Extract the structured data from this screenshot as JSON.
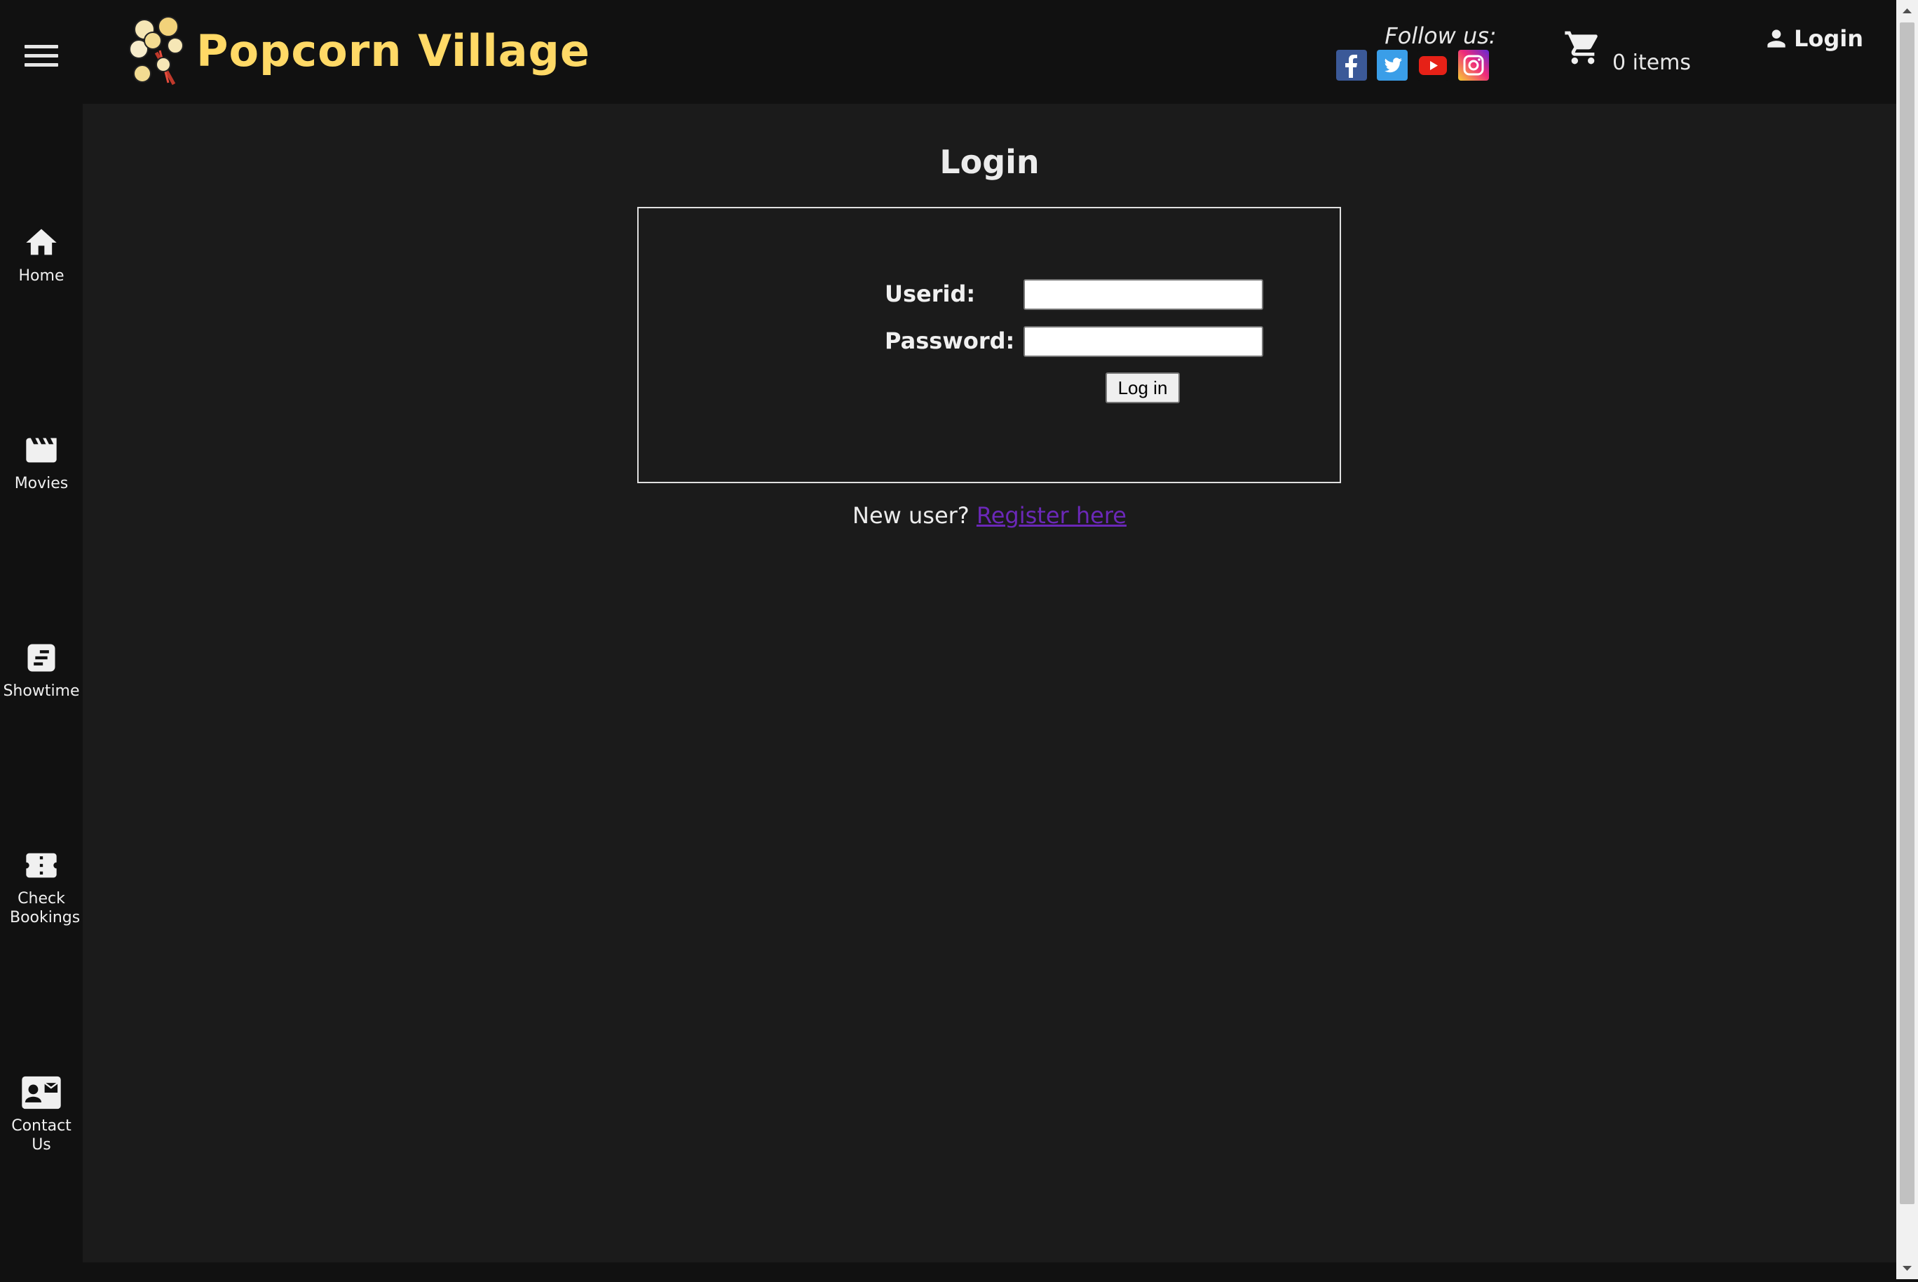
{
  "header": {
    "brand": "Popcorn Village",
    "follow_label": "Follow us:",
    "socials": [
      "facebook",
      "twitter",
      "youtube",
      "instagram"
    ],
    "cart_label": "0 items",
    "login_label": "Login"
  },
  "sidebar": {
    "items": [
      {
        "label": "Home",
        "icon": "home-icon"
      },
      {
        "label": "Movies",
        "icon": "clapperboard-icon"
      },
      {
        "label": "Showtime",
        "icon": "schedule-icon"
      },
      {
        "label": "Check Bookings",
        "icon": "ticket-icon"
      },
      {
        "label": "Contact Us",
        "icon": "contact-card-icon"
      }
    ]
  },
  "main": {
    "title": "Login",
    "form": {
      "userid_label": "Userid:",
      "userid_value": "",
      "password_label": "Password:",
      "password_value": "",
      "submit_label": "Log in"
    },
    "register_prompt": "New user?",
    "register_link": "Register here"
  },
  "colors": {
    "background": "#1b1b1b",
    "header_background": "#111111",
    "brand": "#ffd966",
    "link": "#6b28b8"
  }
}
